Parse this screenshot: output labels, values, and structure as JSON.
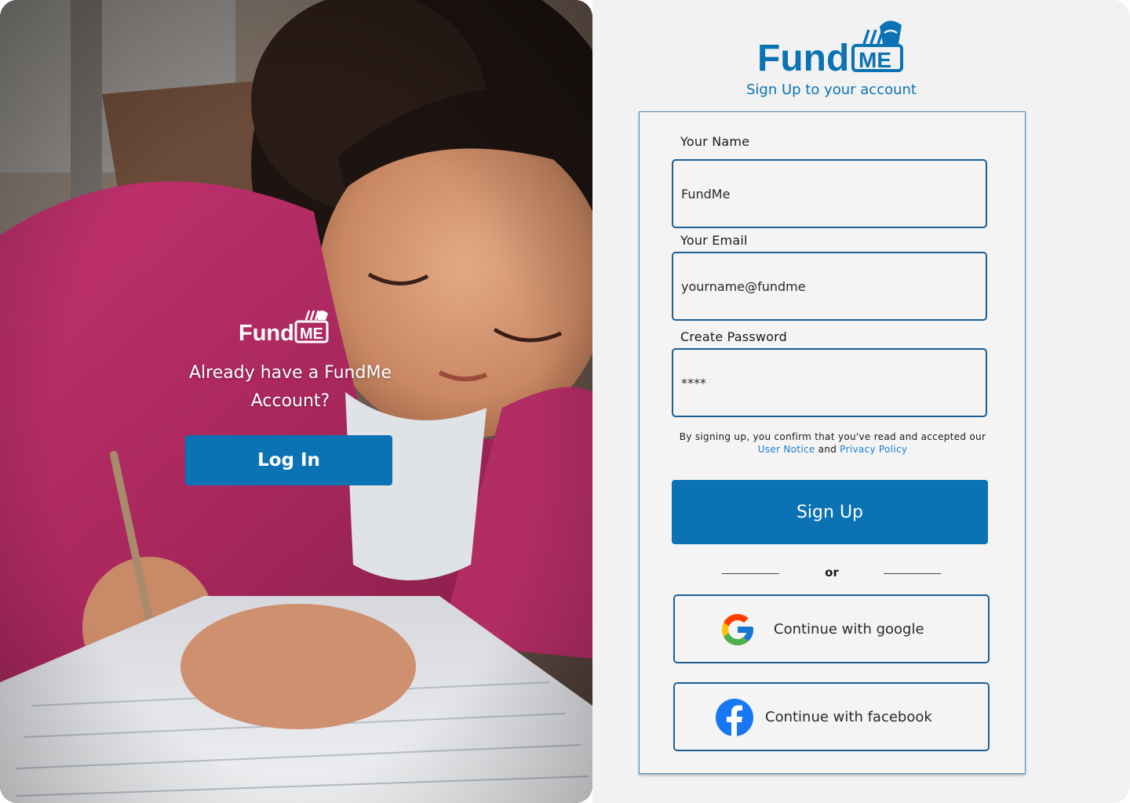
{
  "brand": {
    "name_part1": "Fund",
    "name_part2": "ME"
  },
  "hero": {
    "title": "Already have a FundMe Account?",
    "login_label": "Log In"
  },
  "form": {
    "subtitle": "Sign Up to your account",
    "name_label": "Your Name",
    "name_placeholder": "FundMe",
    "email_label": "Your Email",
    "email_placeholder": "yourname@fundme",
    "password_label": "Create Password",
    "password_placeholder": "****",
    "legal_text": "By signing up, you confirm that you've read and accepted our",
    "user_notice": "User Notice",
    "and": "and",
    "privacy_policy": "Privacy Policy",
    "signup_label": "Sign Up",
    "divider_text": "or",
    "google_label": "Continue with google",
    "facebook_label": "Continue with facebook"
  },
  "colors": {
    "primary": "#0b73b4",
    "border": "#1c5f93",
    "panel_bg": "#f2f2f2",
    "link": "#1a7fd0"
  }
}
